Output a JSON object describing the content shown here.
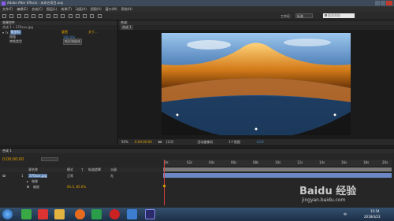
{
  "window": {
    "title": "Adobe After Effects - 未命名项目.aep"
  },
  "menu": [
    "文件(F)",
    "编辑(E)",
    "合成(C)",
    "图层(L)",
    "效果(T)",
    "动画(A)",
    "视图(V)",
    "窗口(W)",
    "帮助(H)"
  ],
  "toolbar": {
    "workspace_label": "工作区:",
    "workspace_value": "标准",
    "search_placeholder": "搜索帮助"
  },
  "effect_controls": {
    "tab": "效果控件",
    "layer": "合成 1 • 370xxx.jpg",
    "columns": [
      "重置",
      "关于..."
    ],
    "effects": [
      {
        "name": "极坐标",
        "param": "插值",
        "value": "100.0%"
      },
      {
        "name": "转换类型",
        "value": "矩形到极线"
      }
    ]
  },
  "comp": {
    "tab": "合成:",
    "zoom": "50%",
    "timecode": "0:00:00:00",
    "resolution": "(1/2)",
    "camera": "活动摄像机",
    "views": "1个视图",
    "offset": "+0.0"
  },
  "timeline": {
    "tab": "合成 1",
    "timecode": "0:00:00:00",
    "search_placeholder": "",
    "columns": [
      "源名称",
      "模式",
      "T",
      "轨道遮罩",
      "父级"
    ],
    "layers": [
      {
        "index": "1",
        "name": "370xxx.jpg",
        "mode": "正常",
        "parent": "无"
      }
    ],
    "sub_rows": [
      {
        "label": "效果"
      },
      {
        "label": "缩放",
        "value": "85.0, 85.0%"
      }
    ],
    "ruler": [
      "0s",
      "02s",
      "04s",
      "06s",
      "08s",
      "10s",
      "12s",
      "14s",
      "16s",
      "18s",
      "20s"
    ]
  },
  "taskbar": {
    "time": "15:54",
    "date": "2018/4/23",
    "lang": "中"
  },
  "watermark": {
    "text": "Baidu 经验",
    "url": "jingyan.baidu.com"
  },
  "colors": {
    "accent": "#e0a000",
    "layer_bar": "#6c88c4",
    "timecode": "#e0a000"
  }
}
